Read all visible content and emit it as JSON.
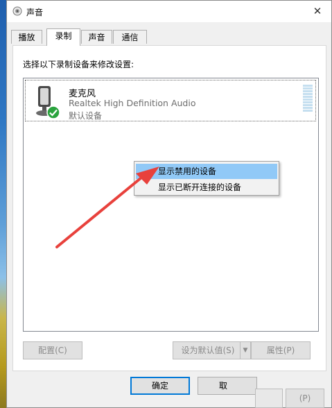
{
  "window": {
    "title": "声音",
    "close_glyph": "✕"
  },
  "tabs": [
    {
      "label": "播放"
    },
    {
      "label": "录制"
    },
    {
      "label": "声音"
    },
    {
      "label": "通信"
    }
  ],
  "recording": {
    "instruction": "选择以下录制设备来修改设置:",
    "device": {
      "name": "麦克风",
      "description": "Realtek High Definition Audio",
      "status": "默认设备"
    }
  },
  "context_menu": {
    "items": [
      {
        "label": "显示禁用的设备"
      },
      {
        "label": "显示已断开连接的设备"
      }
    ]
  },
  "buttons": {
    "configure": "配置(C)",
    "set_default": "设为默认值(S)",
    "properties": "属性(P)",
    "ok": "确定",
    "cancel_fragment": "取",
    "apply_fragment": "(P)"
  },
  "colors": {
    "accent": "#0078d7",
    "highlight": "#91c9f7",
    "arrow": "#e8413c",
    "check": "#2aa33e"
  },
  "icons": [
    "speaker-icon",
    "microphone-icon",
    "default-check-icon",
    "dropdown-arrow-icon",
    "close-icon"
  ]
}
